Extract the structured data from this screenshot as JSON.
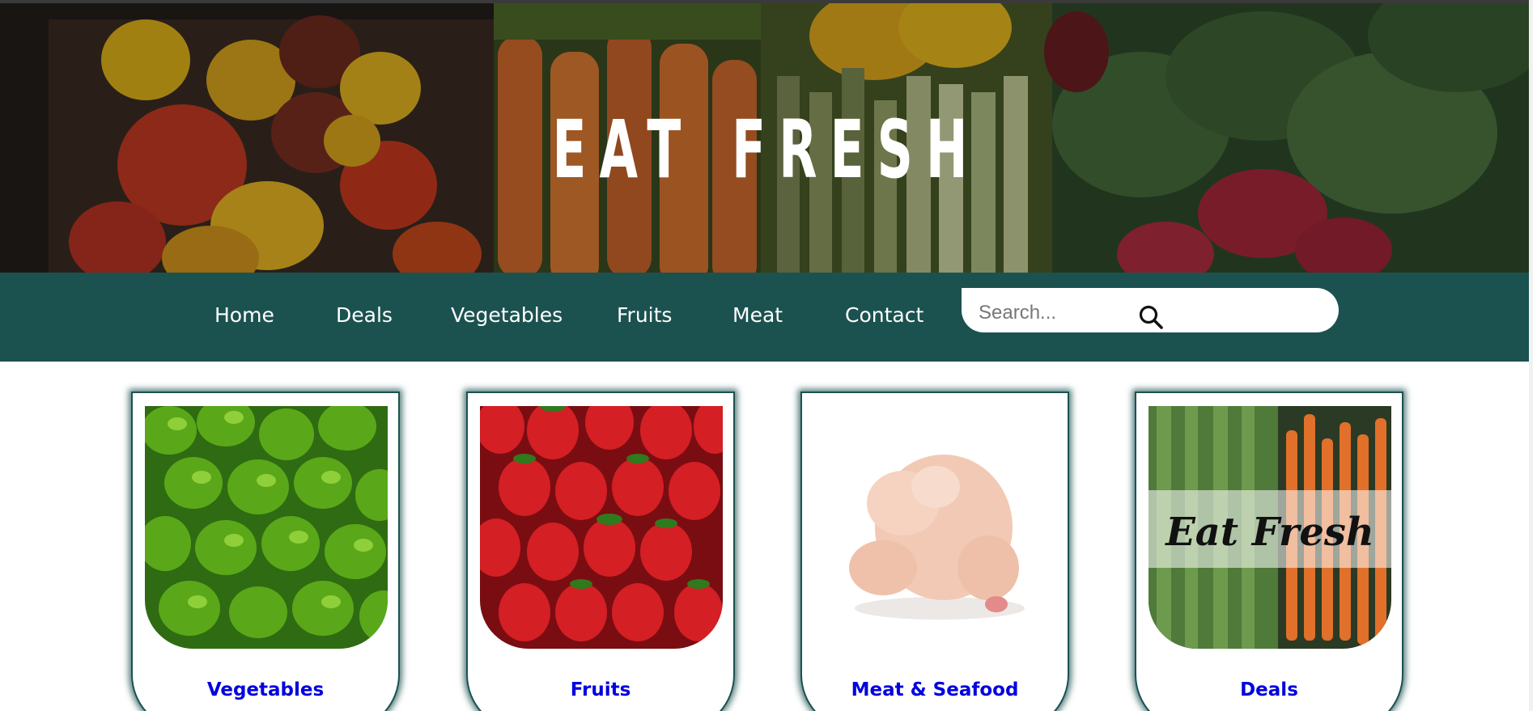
{
  "hero": {
    "title": "Eat Fresh"
  },
  "nav": {
    "links": [
      "Home",
      "Deals",
      "Vegetables",
      "Fruits",
      "Meat",
      "Contact"
    ],
    "search_placeholder": "Search..."
  },
  "cards": [
    {
      "label": "Vegetables",
      "image": "green-peppers"
    },
    {
      "label": "Fruits",
      "image": "strawberries"
    },
    {
      "label": "Meat & Seafood",
      "image": "raw-chicken"
    },
    {
      "label": "Deals",
      "image": "eat-fresh-produce-banner",
      "banner_text": "Eat Fresh"
    }
  ],
  "colors": {
    "nav_background": "#1b5250",
    "card_border": "#1b5250",
    "card_label": "#0000e0",
    "hero_title": "#ffffff"
  }
}
